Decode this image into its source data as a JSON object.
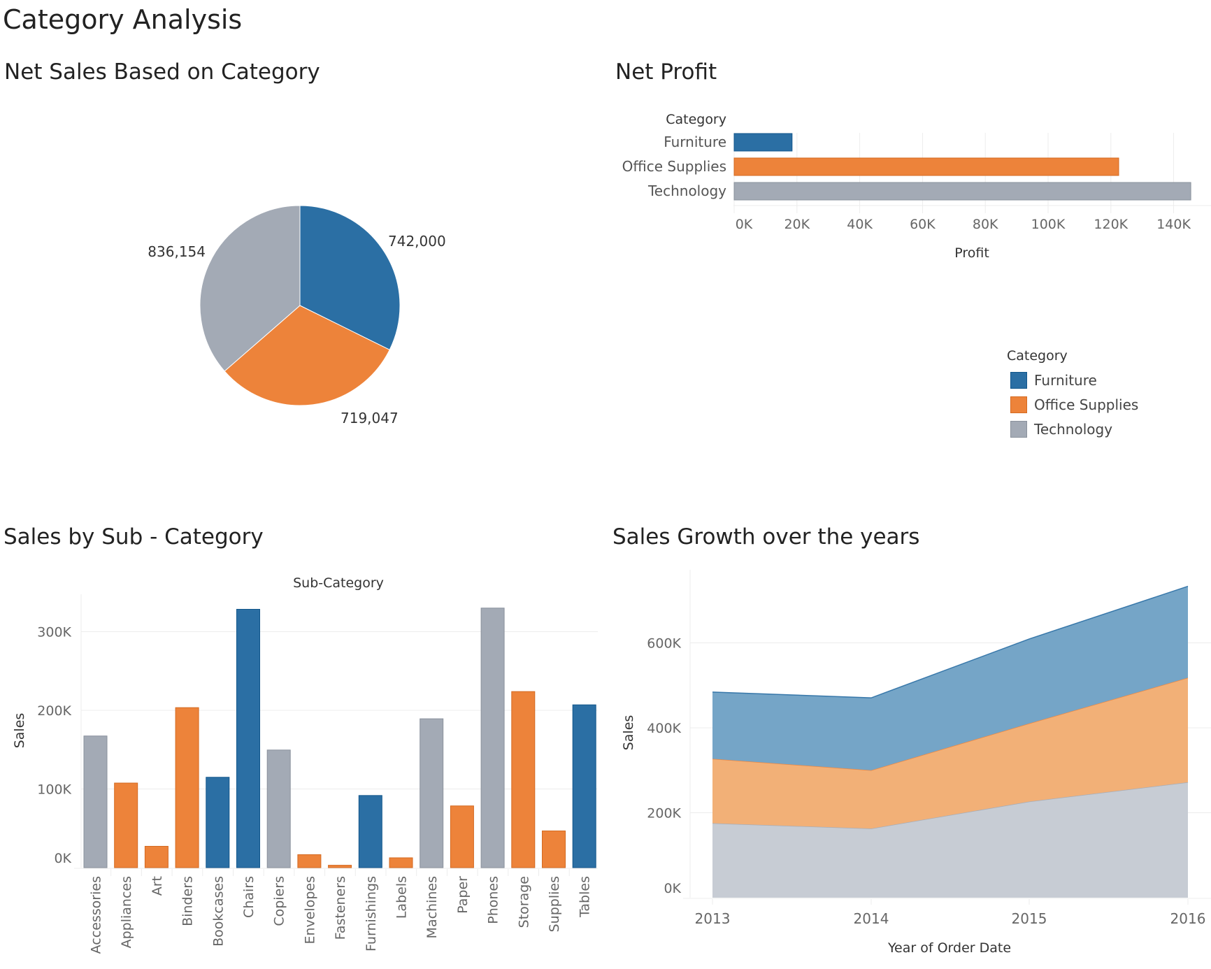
{
  "page": {
    "title": "Category Analysis"
  },
  "colors": {
    "Furniture": "#2b6fa4",
    "Office Supplies": "#ed833a",
    "Technology": "#a3aab5",
    "Furniture_area": "#75a5c7",
    "Office Supplies_area": "#f2b077",
    "Technology_area": "#c7ccd4",
    "grid": "#ececec"
  },
  "legend": {
    "title": "Category",
    "items": [
      "Furniture",
      "Office Supplies",
      "Technology"
    ]
  },
  "chart_data": [
    {
      "type": "pie",
      "title": "Net Sales Based on Category",
      "categories": [
        "Furniture",
        "Office Supplies",
        "Technology"
      ],
      "values": [
        742000,
        719047,
        836154
      ],
      "labels": [
        "742,000",
        "719,047",
        "836,154"
      ]
    },
    {
      "type": "bar",
      "orientation": "horizontal",
      "title": "Net Profit",
      "row_header": "Category",
      "categories": [
        "Furniture",
        "Office Supplies",
        "Technology"
      ],
      "values": [
        18451,
        122491,
        145455
      ],
      "xlabel": "Profit",
      "xlim": [
        0,
        145455
      ],
      "xticks": [
        0,
        20000,
        40000,
        60000,
        80000,
        100000,
        120000,
        140000
      ],
      "xtick_labels": [
        "0K",
        "20K",
        "40K",
        "60K",
        "80K",
        "100K",
        "120K",
        "140K"
      ],
      "grid": true
    },
    {
      "type": "bar",
      "title": "Sales by Sub - Category",
      "header": "Sub-Category",
      "ylabel": "Sales",
      "ylim": [
        0,
        340000
      ],
      "yticks": [
        0,
        100000,
        200000,
        300000
      ],
      "ytick_labels": [
        "0K",
        "100K",
        "200K",
        "300K"
      ],
      "categories": [
        "Accessories",
        "Appliances",
        "Art",
        "Binders",
        "Bookcases",
        "Chairs",
        "Copiers",
        "Envelopes",
        "Fasteners",
        "Furnishings",
        "Labels",
        "Machines",
        "Paper",
        "Phones",
        "Storage",
        "Supplies",
        "Tables"
      ],
      "values": [
        167380,
        107532,
        27119,
        203413,
        114880,
        328449,
        149528,
        16476,
        3024,
        91705,
        12486,
        189239,
        78479,
        330007,
        223844,
        46674,
        206966
      ],
      "category_group": [
        "Technology",
        "Office Supplies",
        "Office Supplies",
        "Office Supplies",
        "Furniture",
        "Furniture",
        "Technology",
        "Office Supplies",
        "Office Supplies",
        "Furniture",
        "Office Supplies",
        "Technology",
        "Office Supplies",
        "Technology",
        "Office Supplies",
        "Office Supplies",
        "Furniture"
      ],
      "grid": true
    },
    {
      "type": "area",
      "stacked": true,
      "title": "Sales Growth over the years",
      "xlabel": "Year of Order Date",
      "ylabel": "Sales",
      "x": [
        "2013",
        "2014",
        "2015",
        "2016"
      ],
      "ylim": [
        0,
        740000
      ],
      "yticks": [
        0,
        200000,
        400000,
        600000
      ],
      "ytick_labels": [
        "0K",
        "200K",
        "400K",
        "600K"
      ],
      "series": [
        {
          "name": "Technology",
          "values": [
            175278,
            162780,
            226364,
            271731
          ]
        },
        {
          "name": "Office Supplies",
          "values": [
            151776,
            137233,
            183940,
            246097
          ]
        },
        {
          "name": "Furniture",
          "values": [
            157193,
            170518,
            198901,
            215387
          ]
        }
      ],
      "grid": true
    }
  ]
}
